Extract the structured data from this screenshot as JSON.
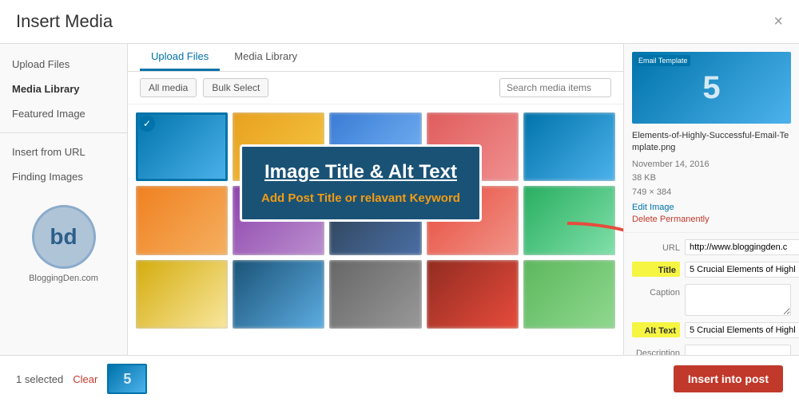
{
  "modal": {
    "title": "Insert Media",
    "close_label": "×"
  },
  "sidebar": {
    "items": [
      {
        "id": "upload-files",
        "label": "Upload Files",
        "active": false
      },
      {
        "id": "media-library",
        "label": "Media Library",
        "active": true
      },
      {
        "id": "featured-image",
        "label": "Featured Image",
        "active": false
      },
      {
        "id": "insert-from-url",
        "label": "Insert from URL",
        "active": false
      },
      {
        "id": "finding-images",
        "label": "Finding Images",
        "active": false
      }
    ],
    "logo": {
      "initials": "bd",
      "site_name": "BloggingDen.com"
    }
  },
  "tabs": [
    {
      "id": "upload-files",
      "label": "Upload Files",
      "active": true
    },
    {
      "id": "media-library",
      "label": "Media Library",
      "active": false
    }
  ],
  "toolbar": {
    "filter_btn": "All media",
    "bulk_btn": "Bulk Select",
    "search_placeholder": "Search media items"
  },
  "attachment": {
    "filename": "Elements-of-Highly-Successful-Email-Template.png",
    "date": "November 14, 2016",
    "filesize": "38 KB",
    "dimensions": "749 × 384",
    "edit_link": "Edit Image",
    "delete_link": "Delete Permanently",
    "fields": {
      "url_label": "URL",
      "url_value": "http://www.bloggingden.c",
      "title_label": "Title",
      "title_value": "5 Crucial Elements of Highl",
      "caption_label": "Caption",
      "caption_value": "",
      "alt_text_label": "Alt Text",
      "alt_text_value": "5 Crucial Elements of Highl",
      "description_label": "Description",
      "description_value": ""
    }
  },
  "annotation": {
    "title": "Image Title & Alt Text",
    "subtitle": "Add Post Title or relavant Keyword"
  },
  "footer": {
    "selected_count": "1 selected",
    "clear_label": "Clear",
    "insert_btn": "Insert into post"
  },
  "preview": {
    "number": "5"
  }
}
